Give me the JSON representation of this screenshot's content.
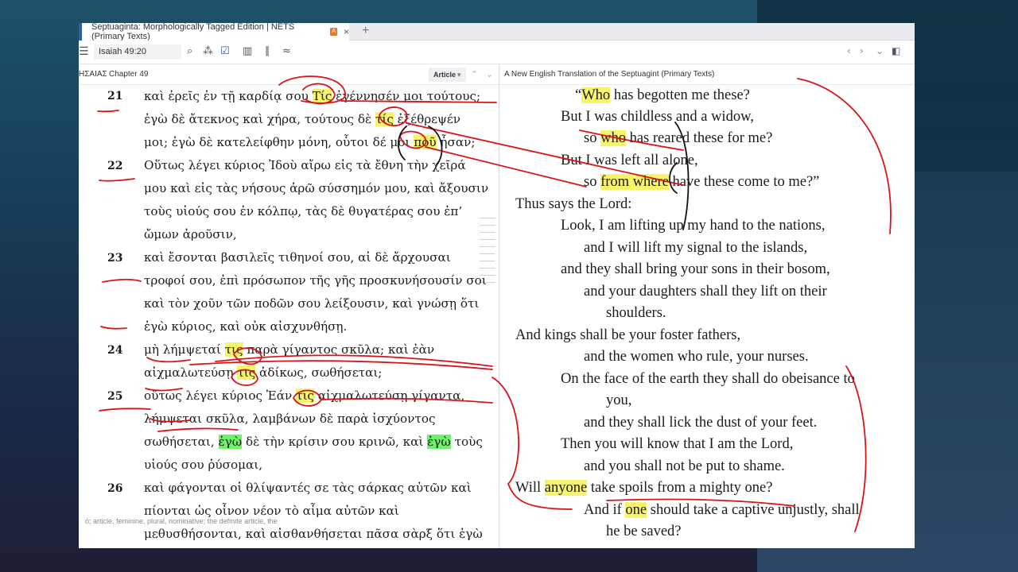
{
  "colors": {
    "highlight_yellow": "#f7f36a",
    "highlight_green": "#6ef26a",
    "ink_red": "#d8141a",
    "tab_accent": "#2a5ea8"
  },
  "tab": {
    "title": "Septuaginta: Morphologically Tagged Edition | NETS (Primary Texts)",
    "lock_label": "A",
    "close": "×",
    "new_tab": "+"
  },
  "toolbar": {
    "menu_icon": "hamburger-icon",
    "reference": "Isaiah 49:20",
    "icons": [
      "search-icon",
      "visual-filter-icon",
      "check-icon",
      "columns-icon",
      "parallel-icon",
      "link-icon"
    ],
    "right_icons": [
      "back-icon",
      "forward-icon",
      "chevron-down-icon",
      "panel-icon"
    ]
  },
  "left_pane": {
    "breadcrumb_book": "ΗΣΑΙΑΣ",
    "breadcrumb_chapter": "Chapter 49",
    "article_button": "Article",
    "hover_text": "ὁ; article, feminine, plural, nominative; the definite article, the",
    "verse_numbers": [
      "21",
      "22",
      "23",
      "24",
      "25",
      "26"
    ]
  },
  "right_pane": {
    "title": "A New English Translation of the Septuagint (Primary Texts)"
  }
}
